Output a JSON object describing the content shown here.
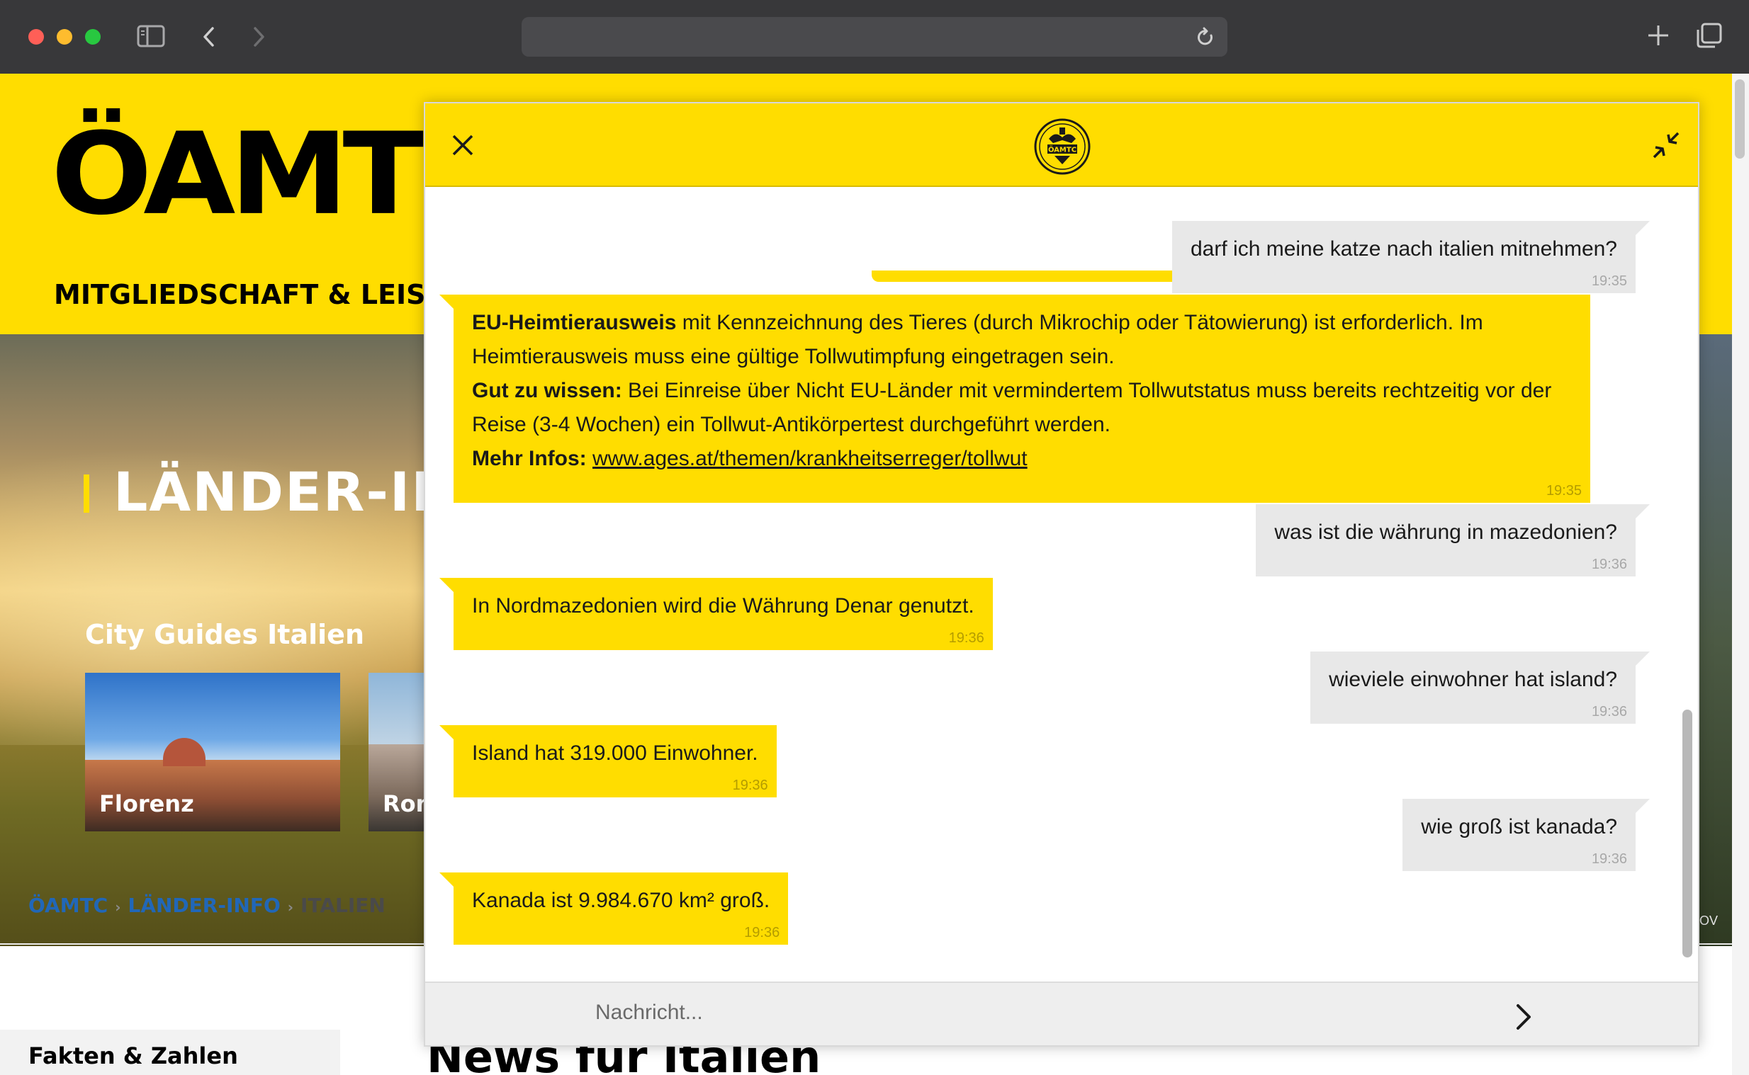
{
  "browser": {
    "traffic_lights": [
      "#ff5f57",
      "#febc2e",
      "#28c840"
    ],
    "icons": [
      "sidebar-icon",
      "back-icon",
      "forward-icon",
      "reload-icon",
      "new-tab-icon",
      "tabs-overview-icon"
    ]
  },
  "site": {
    "logo": "ÖAMTC",
    "nav_label": "MITGLIEDSCHAFT & LEISTU",
    "hero_title": "LÄNDER-INF",
    "city_guides_heading": "City Guides Italien",
    "city_cards": [
      {
        "name": "Florenz"
      },
      {
        "name": "Rom"
      }
    ],
    "right_strip_text": "OV",
    "breadcrumb": [
      {
        "label": "ÖAMTC"
      },
      {
        "label": "LÄNDER-INFO"
      },
      {
        "label": "ITALIEN"
      }
    ],
    "facts_heading": "Fakten & Zahlen",
    "news_heading": "News für Italien",
    "colors": {
      "brand_yellow": "#ffdd00",
      "link_blue": "#2167b8"
    }
  },
  "chat": {
    "logo_text": "ÖAMTC",
    "icons": {
      "close": "close-icon",
      "minimize": "minimize-icon",
      "send": "send-arrow-icon"
    },
    "messages": [
      {
        "from": "user",
        "text": "darf ich meine katze nach italien mitnehmen?",
        "time": "19:35"
      },
      {
        "from": "bot",
        "time": "19:35",
        "p1_bold": "EU-Heimtierausweis",
        "p1_rest": " mit Kennzeichnung des Tieres (durch Mikrochip oder Tätowierung) ist erforderlich. Im",
        "p1_line2": "Heimtierausweis muss eine gültige Tollwutimpfung eingetragen sein.",
        "p2_bold": "Gut zu wissen:",
        "p2_rest": " Bei Einreise über Nicht EU-Länder mit vermindertem Tollwutstatus muss bereits rechtzeitig vor der",
        "p2_line2": "Reise (3-4 Wochen) ein Tollwut-Antikörpertest durchgeführt werden.",
        "p3_bold": "Mehr Infos:",
        "p3_link": "www.ages.at/themen/krankheitserreger/tollwut"
      },
      {
        "from": "user",
        "text": "was ist die währung in mazedonien?",
        "time": "19:36"
      },
      {
        "from": "bot",
        "text": "In Nordmazedonien wird die Währung Denar genutzt.",
        "time": "19:36"
      },
      {
        "from": "user",
        "text": "wieviele einwohner hat island?",
        "time": "19:36"
      },
      {
        "from": "bot",
        "text": "Island hat 319.000 Einwohner.",
        "time": "19:36"
      },
      {
        "from": "user",
        "text": "wie groß ist kanada?",
        "time": "19:36"
      },
      {
        "from": "bot",
        "text": "Kanada ist 9.984.670 km² groß.",
        "time": "19:36"
      }
    ],
    "input_placeholder": "Nachricht..."
  }
}
